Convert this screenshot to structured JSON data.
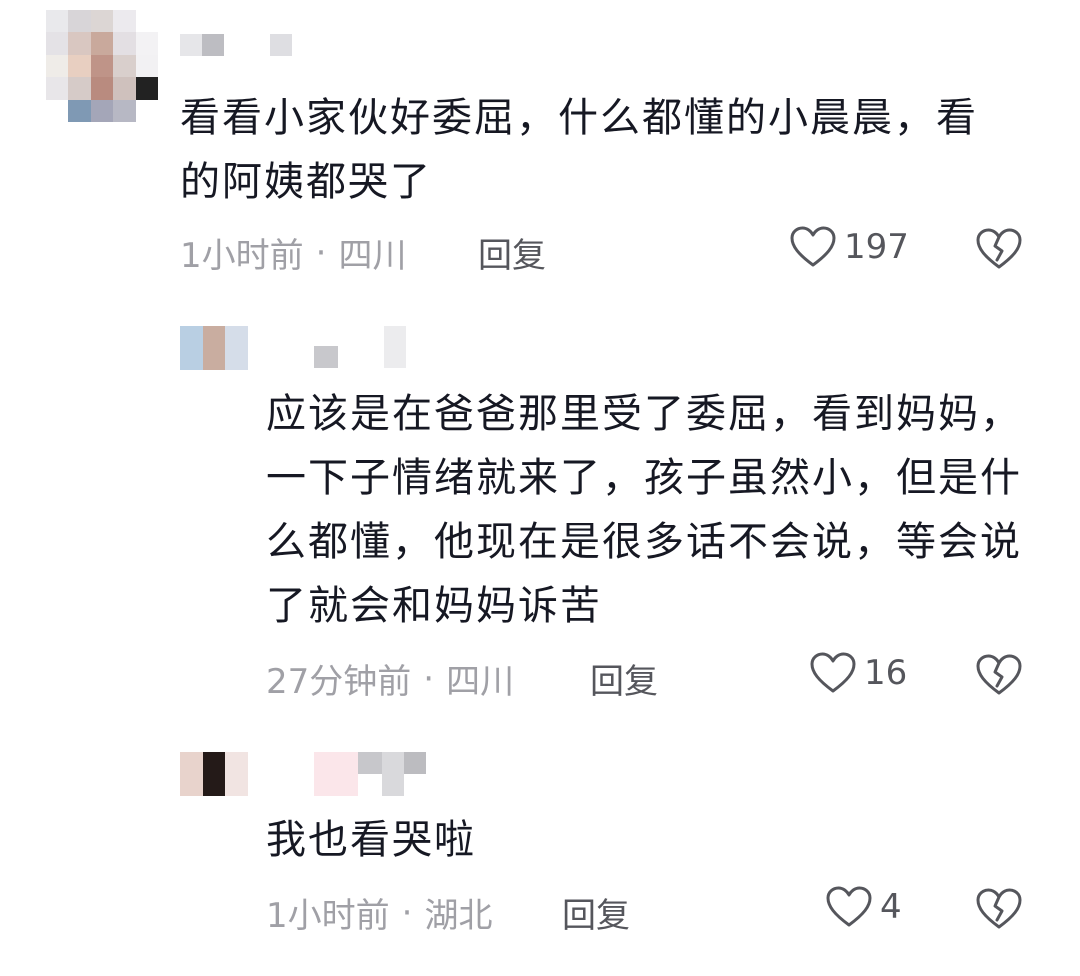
{
  "colors": {
    "meta": "#a0a0a6",
    "icon": "#55565c",
    "text": "#161823"
  },
  "comments": [
    {
      "text": "看看小家伙好委屈，什么都懂的小晨晨，看的阿姨都哭了",
      "time": "1小时前",
      "location": "四川",
      "reply_label": "回复",
      "likes": "197",
      "like_icon": "heart-outline-icon",
      "dislike_icon": "broken-heart-icon"
    },
    {
      "text": "应该是在爸爸那里受了委屈，看到妈妈，一下子情绪就来了，孩子虽然小，但是什么都懂，他现在是很多话不会说，等会说了就会和妈妈诉苦",
      "time": "27分钟前",
      "location": "四川",
      "reply_label": "回复",
      "likes": "16",
      "like_icon": "heart-outline-icon",
      "dislike_icon": "broken-heart-icon"
    },
    {
      "text": "我也看哭啦",
      "time": "1小时前",
      "location": "湖北",
      "reply_label": "回复",
      "likes": "4",
      "like_icon": "heart-outline-icon",
      "dislike_icon": "broken-heart-icon"
    }
  ],
  "meta_separator": "·"
}
